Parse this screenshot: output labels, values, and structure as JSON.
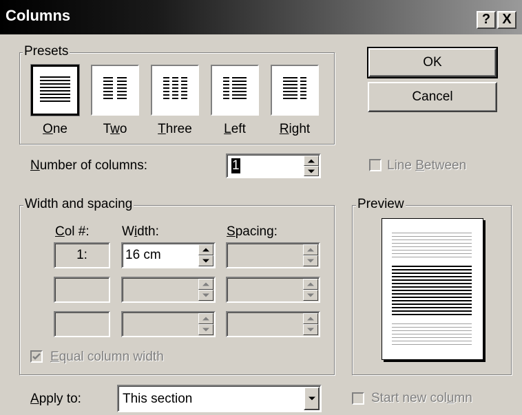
{
  "dialog": {
    "title": "Columns",
    "help_button": "?",
    "close_button": "X"
  },
  "presets": {
    "legend": "Presets",
    "items": [
      {
        "label": "One",
        "mnemonic": "O",
        "rest": "ne",
        "selected": true
      },
      {
        "label": "Two",
        "pre": "T",
        "mnemonic": "w",
        "rest": "o"
      },
      {
        "label": "Three",
        "mnemonic": "T",
        "rest": "hree"
      },
      {
        "label": "Left",
        "mnemonic": "L",
        "rest": "eft"
      },
      {
        "label": "Right",
        "mnemonic": "R",
        "rest": "ight"
      }
    ]
  },
  "buttons": {
    "ok": "OK",
    "cancel": "Cancel"
  },
  "number_of_columns": {
    "label_mnemonic": "N",
    "label_rest": "umber of columns:",
    "value": "1"
  },
  "line_between": {
    "label_mnemonic": "B",
    "label_pre": "Line ",
    "label_rest": "etween",
    "checked": false
  },
  "width_spacing": {
    "legend": "Width and spacing",
    "col_header_mnemonic": "C",
    "col_header_rest": "ol #:",
    "width_header_pre": "W",
    "width_header_mnemonic": "i",
    "width_header_rest": "dth:",
    "spacing_header_mnemonic": "S",
    "spacing_header_rest": "pacing:",
    "rows": [
      {
        "col": "1:",
        "width": "16 cm",
        "spacing": ""
      },
      {
        "col": "",
        "width": "",
        "spacing": ""
      },
      {
        "col": "",
        "width": "",
        "spacing": ""
      }
    ]
  },
  "equal_column_width": {
    "label_mnemonic": "E",
    "label_rest": "qual column width",
    "checked": true
  },
  "preview": {
    "legend": "Preview"
  },
  "apply_to": {
    "label_mnemonic": "A",
    "label_rest": "pply to:",
    "value": "This section"
  },
  "start_new_column": {
    "label_pre": "Start new col",
    "label_mnemonic": "u",
    "label_rest": "mn",
    "checked": false
  }
}
